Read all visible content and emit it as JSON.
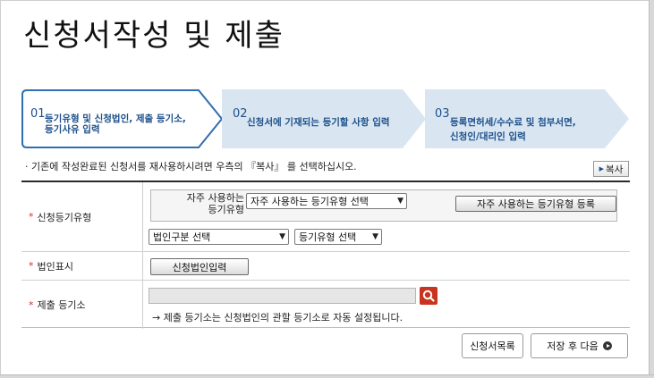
{
  "page": {
    "title": "신청서작성 및 제출"
  },
  "steps": [
    {
      "num": "01",
      "line1": "등기유형 및 신청법인, 제출 등기소,",
      "line2": "등기사유 입력"
    },
    {
      "num": "02",
      "line1": "신청서에 기재되는 등기할 사항 입력",
      "line2": ""
    },
    {
      "num": "03",
      "line1": "등록면허세/수수료 및 첨부서면,",
      "line2": "신청인/대리인 입력"
    }
  ],
  "notice": {
    "text": "· 기존에 작성완료된 신청서를 재사용하시려면 우측의 『복사』 를 선택하십시오.",
    "copy_label": "복사"
  },
  "form": {
    "type_row": {
      "label": "신청등기유형",
      "fav_label_line1": "자주 사용하는",
      "fav_label_line2": "등기유형",
      "fav_select": "자주 사용하는 등기유형 선택",
      "fav_register_label": "자주 사용하는 등기유형 등록",
      "corp_select": "법인구분 선택",
      "type_select": "등기유형 선택"
    },
    "corp_row": {
      "label": "법인표시",
      "button_label": "신청법인입력"
    },
    "office_row": {
      "label": "제출 등기소",
      "input_value": "",
      "hint": "→ 제출 등기소는 신청법인의 관할 등기소로 자동 설정됩니다."
    }
  },
  "footer": {
    "list_label": "신청서목록",
    "next_label": "저장 후 다음"
  },
  "colors": {
    "accent": "#1d4f8a",
    "step_bg": "#d9e6f2",
    "step_active_border": "#2e6fb0",
    "required": "#d0312d",
    "search": "#c9331f"
  }
}
